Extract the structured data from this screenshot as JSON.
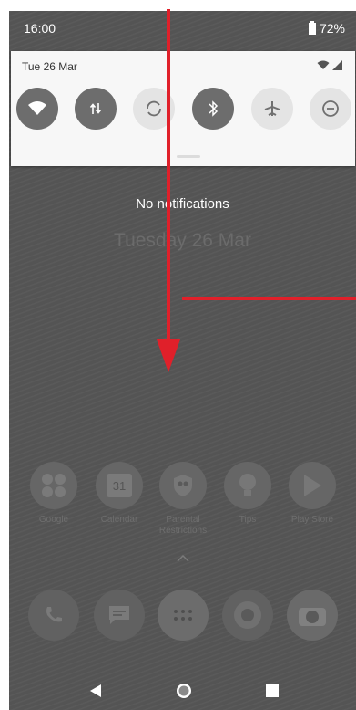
{
  "status_bar": {
    "time": "16:00",
    "battery": "72%"
  },
  "quick_settings": {
    "date": "Tue 26 Mar",
    "tiles": [
      {
        "icon": "wifi-icon",
        "state": "on"
      },
      {
        "icon": "mobile-data-icon",
        "state": "on"
      },
      {
        "icon": "auto-rotate-icon",
        "state": "off"
      },
      {
        "icon": "bluetooth-icon",
        "state": "on"
      },
      {
        "icon": "airplane-mode-icon",
        "state": "off"
      },
      {
        "icon": "do-not-disturb-icon",
        "state": "off"
      }
    ]
  },
  "notifications": {
    "empty_text": "No notifications"
  },
  "lock_screen": {
    "date": "Tuesday 26 Mar"
  },
  "home": {
    "apps": [
      {
        "label": "Google",
        "icon": "google-folder-icon"
      },
      {
        "label": "Calendar",
        "icon": "calendar-icon",
        "badge": "31"
      },
      {
        "label": "Parental Restrictions",
        "icon": "parental-restrictions-icon"
      },
      {
        "label": "Tips",
        "icon": "tips-icon"
      },
      {
        "label": "Play Store",
        "icon": "play-store-icon"
      }
    ],
    "dock": [
      {
        "icon": "phone-icon"
      },
      {
        "icon": "messages-icon"
      },
      {
        "icon": "app-drawer-icon"
      },
      {
        "icon": "chrome-icon"
      },
      {
        "icon": "camera-icon"
      }
    ]
  },
  "navigation": {
    "buttons": [
      "back-icon",
      "home-icon",
      "recents-icon"
    ]
  },
  "colors": {
    "annotation_arrow": "#e0202a",
    "tile_on": "#6d6d6d",
    "tile_off": "#e4e4e4",
    "panel_bg": "#f7f7f7"
  }
}
